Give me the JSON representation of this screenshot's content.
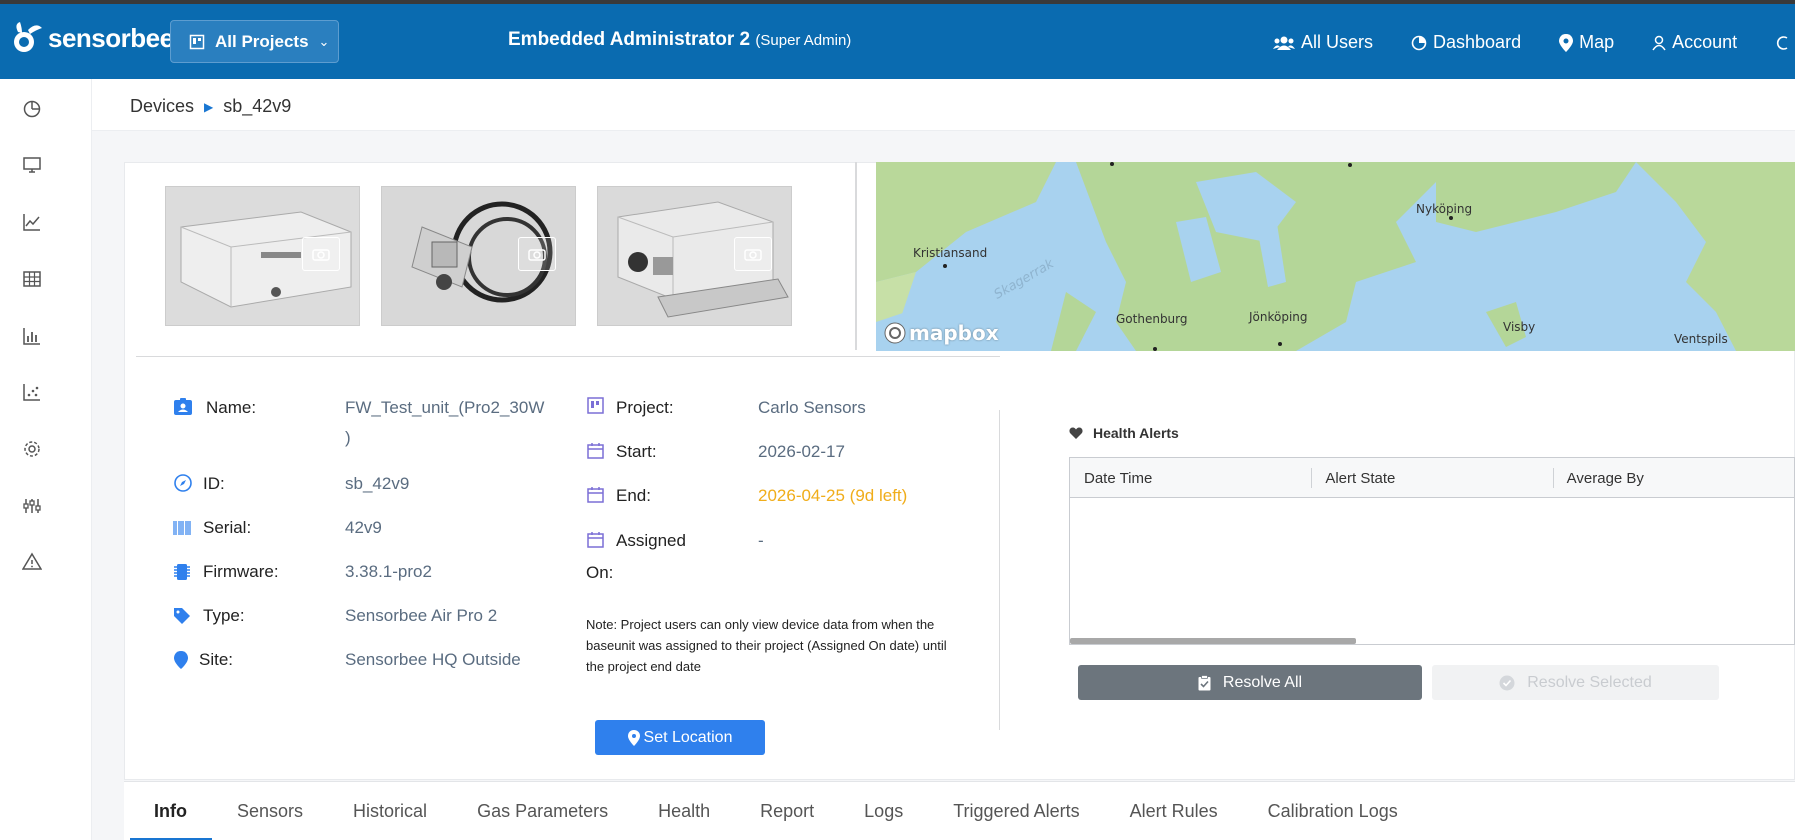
{
  "header": {
    "brand": "sensorbee",
    "project_selector": "All Projects",
    "admin_name": "Embedded Administrator 2",
    "admin_role": "(Super Admin)",
    "nav": [
      {
        "label": "All Users",
        "icon": "users-icon"
      },
      {
        "label": "Dashboard",
        "icon": "pie-chart-icon"
      },
      {
        "label": "Map",
        "icon": "map-pin-icon"
      },
      {
        "label": "Account",
        "icon": "user-icon"
      }
    ]
  },
  "sidebar": {
    "icons": [
      "pie-chart-icon",
      "monitor-icon",
      "line-chart-icon",
      "table-icon",
      "bar-chart-icon",
      "scatter-chart-icon",
      "gear-icon",
      "sliders-icon",
      "warning-icon"
    ]
  },
  "breadcrumb": {
    "root": "Devices",
    "current": "sb_42v9"
  },
  "map": {
    "attribution": "mapbox",
    "labels": [
      "Kristiansand",
      "Skagerrak",
      "Gothenburg",
      "Jönköping",
      "Nyköping",
      "Visby",
      "Ventspils"
    ]
  },
  "device": {
    "name_label": "Name:",
    "name_value": "FW_Test_unit_(Pro2_30W",
    "name_value_cont": ")",
    "id_label": "ID:",
    "id_value": "sb_42v9",
    "serial_label": "Serial:",
    "serial_value": "42v9",
    "firmware_label": "Firmware:",
    "firmware_value": "3.38.1-pro2",
    "type_label": "Type:",
    "type_value": "Sensorbee Air Pro 2",
    "site_label": "Site:",
    "site_value": "Sensorbee HQ Outside"
  },
  "project": {
    "project_label": "Project:",
    "project_value": "Carlo Sensors",
    "start_label": "Start:",
    "start_value": "2026-02-17",
    "end_label": "End:",
    "end_value": "2026-04-25 (9d left)",
    "assigned_label": "Assigned",
    "assigned_label_cont": "On:",
    "assigned_value": "-",
    "note": "Note: Project users can only view device data from when the baseunit was assigned to their project (Assigned On date) until the project end date",
    "end_color": "#f0ad1a"
  },
  "actions": {
    "set_location": "Set Location"
  },
  "health_alerts": {
    "title": "Health Alerts",
    "columns": [
      "Date Time",
      "Alert State",
      "Average By"
    ],
    "resolve_all": "Resolve All",
    "resolve_selected": "Resolve Selected"
  },
  "tabs": [
    "Info",
    "Sensors",
    "Historical",
    "Gas Parameters",
    "Health",
    "Report",
    "Logs",
    "Triggered Alerts",
    "Alert Rules",
    "Calibration Logs"
  ],
  "colors": {
    "header_bg": "#0a6bb0",
    "accent": "#1976d2",
    "button_blue": "#2f80ed",
    "muted_value": "#5a6c80"
  }
}
